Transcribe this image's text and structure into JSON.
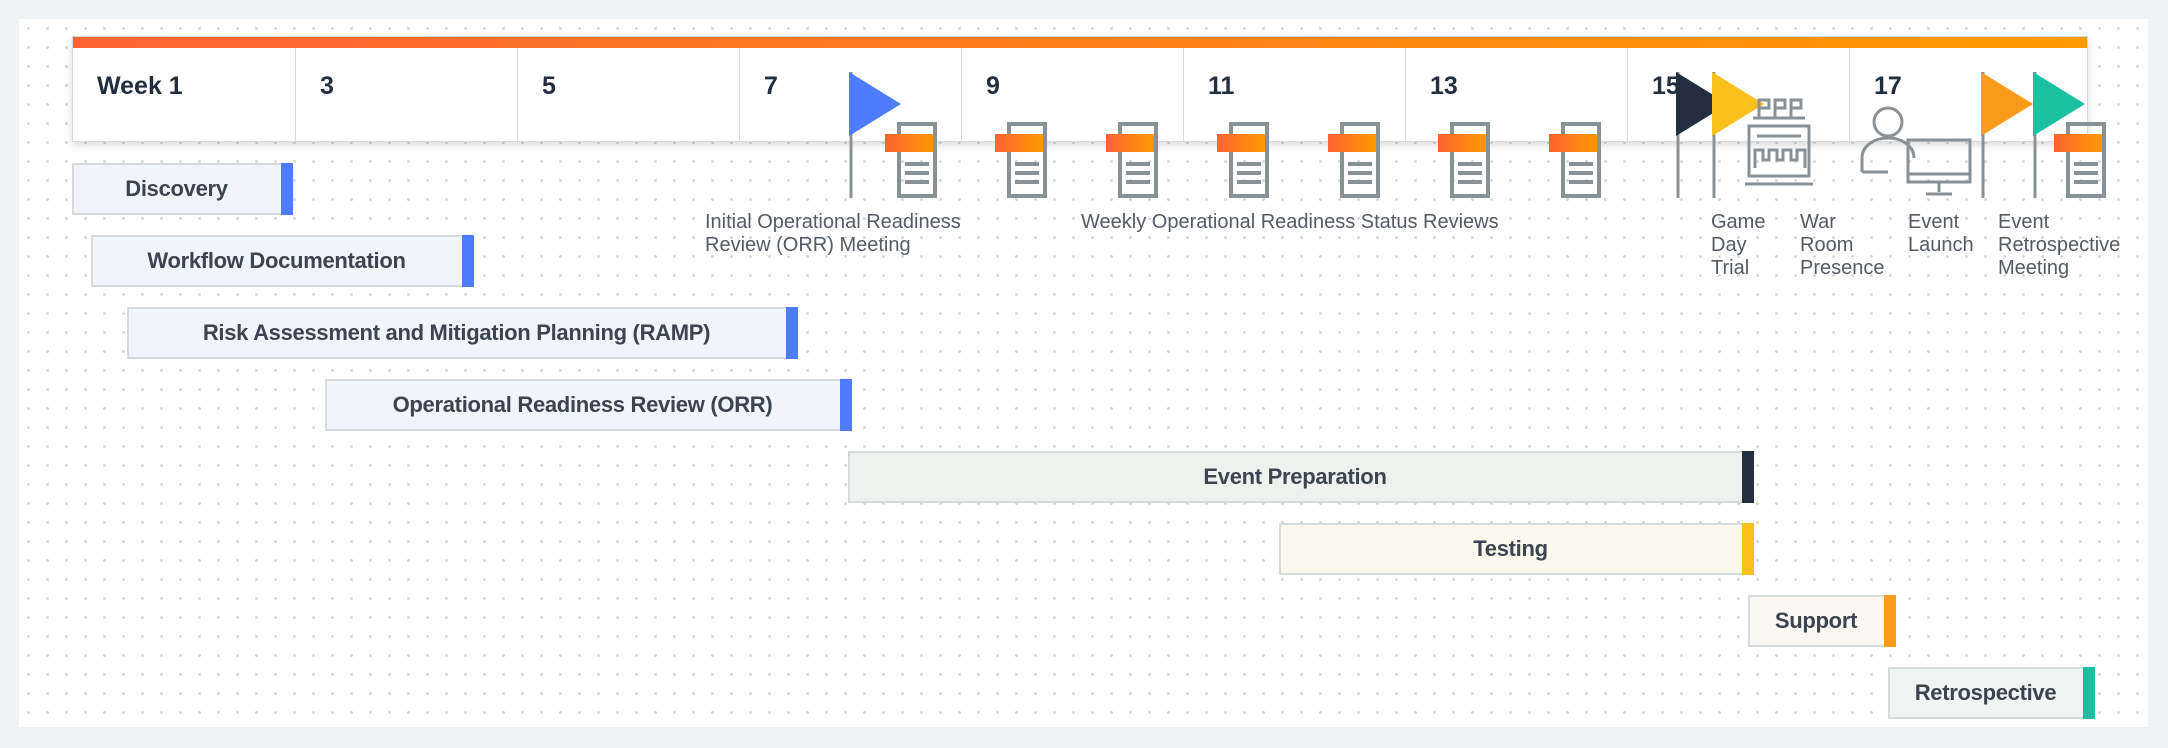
{
  "header": {
    "weeks": [
      "Week 1",
      "3",
      "5",
      "7",
      "9",
      "11",
      "13",
      "15",
      "17"
    ],
    "accent_gradient": [
      "#fe6333",
      "#ff9a00"
    ]
  },
  "tasks": [
    {
      "label": "Discovery",
      "fill": "#f2f4fb",
      "end": "#4d7cfe"
    },
    {
      "label": "Workflow Documentation",
      "fill": "#f2f4fb",
      "end": "#4d7cfe"
    },
    {
      "label": "Risk Assessment and Mitigation Planning (RAMP)",
      "fill": "#f2f4fb",
      "end": "#4d7cfe"
    },
    {
      "label": "Operational Readiness Review (ORR)",
      "fill": "#f2f4fb",
      "end": "#4d7cfe"
    },
    {
      "label": "Event Preparation",
      "fill": "#eff1ef",
      "end": "#232f3e"
    },
    {
      "label": "Testing",
      "fill": "#fbf9ee",
      "end": "#fbc01b"
    },
    {
      "label": "Support",
      "fill": "#fbf7f2",
      "end": "#f89b1a"
    },
    {
      "label": "Retrospective",
      "fill": "#eef5f2",
      "end": "#1cbf9f"
    }
  ],
  "milestones": {
    "labels": [
      "Initial Operational Readiness\nReview (ORR) Meeting",
      "Weekly Operational Readiness Status Reviews",
      "Game\nDay\nTrial",
      "War\nRoom\nPresence",
      "Event\nLaunch",
      "Event\nRetrospective\nMeeting"
    ],
    "flag_colors": {
      "orr": "#4d7cfe",
      "game_day": "#232f3e",
      "trial": "#fbc01b",
      "launch": "#f89b1a",
      "retro": "#1cbf9f"
    },
    "icons": [
      "flag-icon",
      "document-icon",
      "war-room-icon",
      "person-icon",
      "monitor-icon"
    ]
  }
}
